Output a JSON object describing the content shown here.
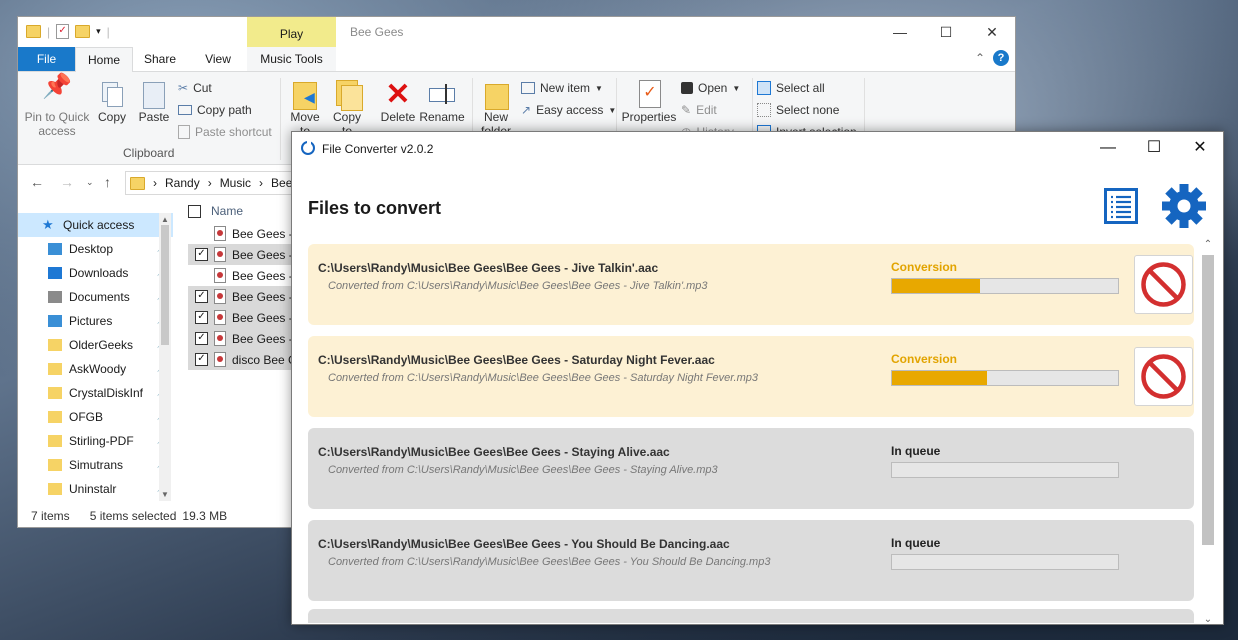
{
  "explorer": {
    "title": "Bee Gees",
    "context_tab": "Play",
    "tabs": [
      "File",
      "Home",
      "Share",
      "View",
      "Music Tools"
    ],
    "ribbon": {
      "pin": "Pin to Quick access",
      "copy": "Copy",
      "paste": "Paste",
      "cut": "Cut",
      "copy_path": "Copy path",
      "paste_shortcut": "Paste shortcut",
      "clipboard_group": "Clipboard",
      "move_to": "Move to",
      "copy_to": "Copy to",
      "delete": "Delete",
      "rename": "Rename",
      "new_folder": "New folder",
      "new_item": "New item",
      "easy_access": "Easy access",
      "properties": "Properties",
      "open": "Open",
      "edit": "Edit",
      "history": "History",
      "select_all": "Select all",
      "select_none": "Select none",
      "invert_selection": "Invert selection"
    },
    "breadcrumb": [
      "Randy",
      "Music",
      "Bee"
    ],
    "sidebar": [
      {
        "label": "Quick access",
        "selected": true,
        "pinned": false
      },
      {
        "label": "Desktop",
        "pinned": true
      },
      {
        "label": "Downloads",
        "pinned": true
      },
      {
        "label": "Documents",
        "pinned": true
      },
      {
        "label": "Pictures",
        "pinned": true
      },
      {
        "label": "OlderGeeks",
        "pinned": true
      },
      {
        "label": "AskWoody",
        "pinned": true
      },
      {
        "label": "CrystalDiskInf",
        "pinned": true
      },
      {
        "label": "OFGB",
        "pinned": true
      },
      {
        "label": "Stirling-PDF",
        "pinned": true
      },
      {
        "label": "Simutrans",
        "pinned": true
      },
      {
        "label": "Uninstalr",
        "pinned": true
      }
    ],
    "column_name": "Name",
    "files": [
      {
        "name": "Bee Gees - J",
        "checked": false
      },
      {
        "name": "Bee Gees - J",
        "checked": true
      },
      {
        "name": "Bee Gees - S",
        "checked": false
      },
      {
        "name": "Bee Gees - S",
        "checked": true
      },
      {
        "name": "Bee Gees - S",
        "checked": true
      },
      {
        "name": "Bee Gees - Y",
        "checked": true
      },
      {
        "name": "disco Bee G",
        "checked": true
      }
    ],
    "status": {
      "items": "7 items",
      "selected": "5 items selected",
      "size": "19.3 MB"
    }
  },
  "converter": {
    "title": "File Converter v2.0.2",
    "heading": "Files to convert",
    "jobs": [
      {
        "path": "C:\\Users\\Randy\\Music\\Bee Gees\\Bee Gees - Jive Talkin'.aac",
        "from": "Converted from  C:\\Users\\Randy\\Music\\Bee Gees\\Bee Gees - Jive Talkin'.mp3",
        "state": "Conversion",
        "progress": 0.39,
        "active": true
      },
      {
        "path": "C:\\Users\\Randy\\Music\\Bee Gees\\Bee Gees - Saturday Night Fever.aac",
        "from": "Converted from  C:\\Users\\Randy\\Music\\Bee Gees\\Bee Gees - Saturday Night Fever.mp3",
        "state": "Conversion",
        "progress": 0.42,
        "active": true
      },
      {
        "path": "C:\\Users\\Randy\\Music\\Bee Gees\\Bee Gees - Staying Alive.aac",
        "from": "Converted from  C:\\Users\\Randy\\Music\\Bee Gees\\Bee Gees - Staying Alive.mp3",
        "state": "In queue",
        "progress": 0,
        "active": false
      },
      {
        "path": "C:\\Users\\Randy\\Music\\Bee Gees\\Bee Gees - You Should Be Dancing.aac",
        "from": "Converted from  C:\\Users\\Randy\\Music\\Bee Gees\\Bee Gees - You Should Be Dancing.mp3",
        "state": "In queue",
        "progress": 0,
        "active": false
      }
    ],
    "colors": {
      "accent": "#1565c0",
      "progress": "#e8a800",
      "cancel": "#d32f2f"
    }
  }
}
